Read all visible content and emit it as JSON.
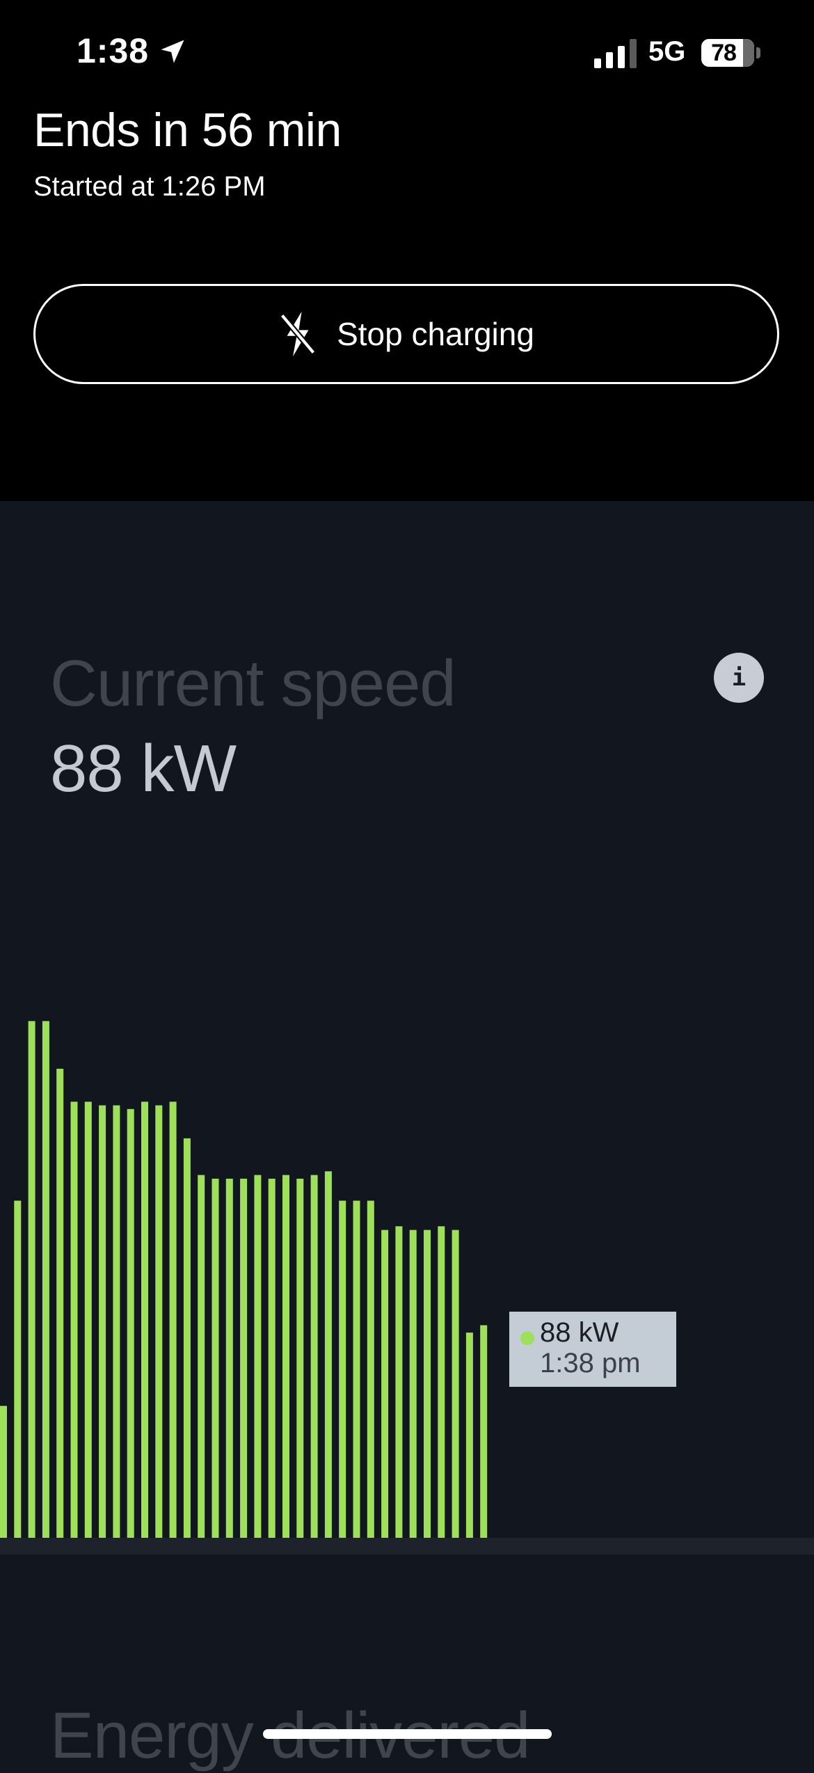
{
  "status_bar": {
    "time": "1:38",
    "network": "5G",
    "battery": "78"
  },
  "session": {
    "ends_text": "Ends in 56 min",
    "started_text": "Started at 1:26 PM"
  },
  "actions": {
    "stop_label": "Stop charging"
  },
  "current_speed": {
    "title": "Current speed",
    "value": "88 kW"
  },
  "tooltip": {
    "value": "88 kW",
    "time": "1:38 pm"
  },
  "energy": {
    "title": "Energy delivered"
  },
  "colors": {
    "bar": "#9fe05a",
    "background": "#12161e",
    "header": "#000000"
  },
  "chart_data": {
    "type": "bar",
    "ylabel": "",
    "xlabel": "",
    "series": [
      {
        "values": [
          36,
          92,
          141,
          141,
          128,
          119,
          119,
          118,
          118,
          117,
          119,
          118,
          119,
          109,
          99,
          98,
          98,
          98,
          99,
          98,
          99,
          98,
          99,
          100,
          92,
          92,
          92,
          84,
          85,
          84,
          84,
          85,
          84,
          56,
          58
        ]
      }
    ],
    "ylim": [
      0,
      150
    ],
    "last_value_label": "88 kW",
    "last_time_label": "1:38 pm"
  }
}
